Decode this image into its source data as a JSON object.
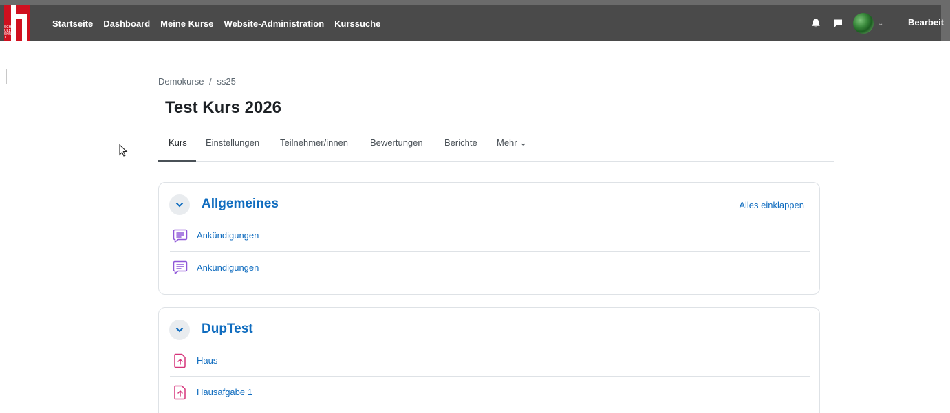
{
  "navbar": {
    "logo_text": "SCHULE SHUT",
    "links": [
      "Startseite",
      "Dashboard",
      "Meine Kurse",
      "Website-Administration",
      "Kurssuche"
    ],
    "edit_mode_label": "Bearbeit",
    "user_menu_caret": "⌄"
  },
  "breadcrumb": {
    "items": [
      "Demokurse",
      "ss25"
    ],
    "separator": "/"
  },
  "page": {
    "title": "Test Kurs 2026"
  },
  "tabs": [
    {
      "label": "Kurs",
      "active": true
    },
    {
      "label": "Einstellungen",
      "active": false
    },
    {
      "label": "Teilnehmer/innen",
      "active": false
    },
    {
      "label": "Bewertungen",
      "active": false
    },
    {
      "label": "Berichte",
      "active": false
    },
    {
      "label": "Mehr ⌄",
      "active": false
    }
  ],
  "sections": [
    {
      "title": "Allgemeines",
      "collapse_all_label": "Alles einklappen",
      "activities": [
        {
          "name": "Ankündigungen",
          "icon": "forum-icon"
        },
        {
          "name": "Ankündigungen",
          "icon": "forum-icon"
        }
      ]
    },
    {
      "title": "DupTest",
      "activities": [
        {
          "name": "Haus",
          "icon": "assignment-icon"
        },
        {
          "name": "Hausafgabe 1",
          "icon": "assignment-icon"
        }
      ]
    }
  ],
  "colors": {
    "navbar": "#4a4a4a",
    "brand_red": "#d0101f",
    "link_blue": "#0f6cbf",
    "forum_purple": "#8f57d8",
    "assignment_pink": "#d6337a"
  }
}
